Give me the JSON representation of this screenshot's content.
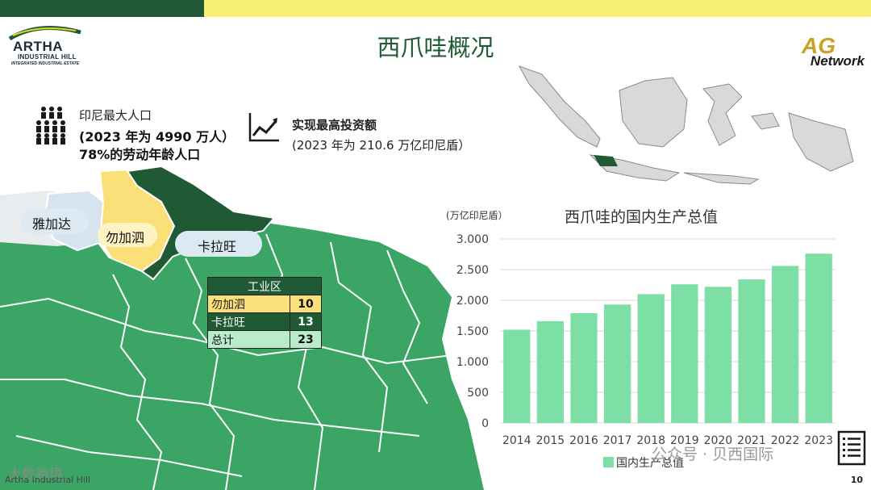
{
  "header": {
    "title": "西爪哇概况",
    "logo_left": {
      "name": "ARTHA",
      "sub": "INDUSTRIAL HILL",
      "tag": "INTEGRATED INDUSTRIAL ESTATE"
    },
    "logo_right": {
      "name": "Network",
      "mark": "AG"
    }
  },
  "stats": {
    "population": {
      "icon": "people-icon",
      "line1": "印尼最大人口",
      "line2": "(2023 年为 4990 万人）",
      "line3": "78%的劳动年龄人口"
    },
    "investment": {
      "icon": "trend-up-icon",
      "line1": "实现最高投资额",
      "line2": "(2023 年为 210.6 万亿印尼盾）"
    }
  },
  "map": {
    "labels": {
      "jakarta": "雅加达",
      "bekasi": "勿加泗",
      "karawang": "卡拉旺"
    },
    "colors": {
      "jakarta": "#d7e3ef",
      "bekasi": "#fbe07a",
      "karawang": "#1f5a35",
      "west_java": "#3aa565"
    }
  },
  "industrial_table": {
    "header": "工业区",
    "rows": [
      {
        "name": "勿加泗",
        "value": "10",
        "bg": "#fbe07a"
      },
      {
        "name": "卡拉旺",
        "value": "13",
        "bg": "#1f5a35"
      },
      {
        "name": "总计",
        "value": "23",
        "bg": "#b8eccb"
      }
    ]
  },
  "chart_data": {
    "type": "bar",
    "title": "西爪哇的国内生产总值",
    "ylabel": "(万亿印尼盾）",
    "categories": [
      "2014",
      "2015",
      "2016",
      "2017",
      "2018",
      "2019",
      "2020",
      "2021",
      "2022",
      "2023"
    ],
    "series": [
      {
        "name": "国内生产总值",
        "values": [
          1520,
          1660,
          1790,
          1930,
          2100,
          2260,
          2220,
          2340,
          2560,
          2760
        ],
        "color": "#7ddea6"
      }
    ],
    "ylim": [
      0,
      3000
    ],
    "yticks": [
      "0",
      "500",
      "1.000",
      "1.500",
      "2.000",
      "2.500",
      "3.000"
    ],
    "grid": true,
    "legend": "bottom"
  },
  "footer": {
    "company": "Artha Industrial Hill",
    "page": "10"
  },
  "watermarks": {
    "wechat_left": "大数跨境",
    "wechat_right": "公众号 · 贝西国际"
  }
}
